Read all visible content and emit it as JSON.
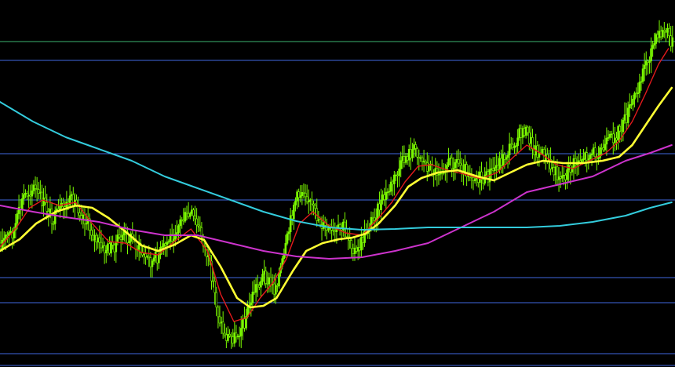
{
  "colors": {
    "background": "#000000",
    "candle": "#7CFC00",
    "horizontal_line_blue": "#4169E1",
    "horizontal_line_green": "#3CB371",
    "ma_red": "#E31A1C",
    "ma_yellow": "#FFFF33",
    "ma_magenta": "#CC33CC",
    "ma_cyan": "#33CCDD"
  },
  "chart_data": {
    "type": "line",
    "x_range": [
      0,
      410
    ],
    "y_range": [
      0,
      468
    ],
    "y_inverted": true,
    "grid": false,
    "legend": "none",
    "horizontal_levels": [
      {
        "color_key": "horizontal_line_green",
        "y": 53
      },
      {
        "color_key": "horizontal_line_blue",
        "y": 77
      },
      {
        "color_key": "horizontal_line_blue",
        "y": 196
      },
      {
        "color_key": "horizontal_line_blue",
        "y": 255
      },
      {
        "color_key": "horizontal_line_blue",
        "y": 354
      },
      {
        "color_key": "horizontal_line_blue",
        "y": 386
      },
      {
        "color_key": "horizontal_line_blue",
        "y": 451
      },
      {
        "color_key": "horizontal_line_blue",
        "y": 466
      }
    ],
    "price_path": [
      [
        0,
        310
      ],
      [
        8,
        295
      ],
      [
        14,
        250
      ],
      [
        20,
        240
      ],
      [
        26,
        260
      ],
      [
        32,
        280
      ],
      [
        38,
        265
      ],
      [
        44,
        255
      ],
      [
        50,
        275
      ],
      [
        56,
        300
      ],
      [
        62,
        320
      ],
      [
        68,
        315
      ],
      [
        74,
        300
      ],
      [
        80,
        305
      ],
      [
        86,
        325
      ],
      [
        92,
        335
      ],
      [
        98,
        320
      ],
      [
        104,
        300
      ],
      [
        110,
        280
      ],
      [
        116,
        275
      ],
      [
        122,
        300
      ],
      [
        128,
        350
      ],
      [
        132,
        400
      ],
      [
        136,
        430
      ],
      [
        142,
        430
      ],
      [
        148,
        410
      ],
      [
        154,
        370
      ],
      [
        160,
        350
      ],
      [
        166,
        370
      ],
      [
        172,
        330
      ],
      [
        178,
        260
      ],
      [
        184,
        240
      ],
      [
        190,
        270
      ],
      [
        196,
        290
      ],
      [
        202,
        300
      ],
      [
        208,
        290
      ],
      [
        212,
        305
      ],
      [
        216,
        325
      ],
      [
        222,
        295
      ],
      [
        228,
        270
      ],
      [
        234,
        250
      ],
      [
        240,
        225
      ],
      [
        246,
        200
      ],
      [
        252,
        190
      ],
      [
        258,
        210
      ],
      [
        264,
        220
      ],
      [
        270,
        210
      ],
      [
        276,
        205
      ],
      [
        282,
        215
      ],
      [
        288,
        225
      ],
      [
        294,
        230
      ],
      [
        300,
        215
      ],
      [
        306,
        200
      ],
      [
        312,
        180
      ],
      [
        318,
        165
      ],
      [
        324,
        190
      ],
      [
        330,
        200
      ],
      [
        336,
        220
      ],
      [
        342,
        225
      ],
      [
        348,
        210
      ],
      [
        354,
        200
      ],
      [
        360,
        195
      ],
      [
        366,
        190
      ],
      [
        372,
        175
      ],
      [
        378,
        160
      ],
      [
        384,
        130
      ],
      [
        390,
        90
      ],
      [
        396,
        60
      ],
      [
        400,
        45
      ],
      [
        404,
        40
      ],
      [
        408,
        55
      ]
    ],
    "series": [
      {
        "color_key": "ma_red",
        "values": [
          [
            0,
            315
          ],
          [
            10,
            290
          ],
          [
            18,
            265
          ],
          [
            26,
            255
          ],
          [
            36,
            262
          ],
          [
            46,
            258
          ],
          [
            56,
            285
          ],
          [
            66,
            308
          ],
          [
            76,
            310
          ],
          [
            86,
            322
          ],
          [
            96,
            325
          ],
          [
            106,
            308
          ],
          [
            116,
            292
          ],
          [
            126,
            320
          ],
          [
            134,
            375
          ],
          [
            142,
            410
          ],
          [
            150,
            405
          ],
          [
            158,
            380
          ],
          [
            166,
            360
          ],
          [
            174,
            330
          ],
          [
            182,
            285
          ],
          [
            190,
            270
          ],
          [
            200,
            288
          ],
          [
            210,
            297
          ],
          [
            220,
            300
          ],
          [
            230,
            278
          ],
          [
            238,
            258
          ],
          [
            246,
            232
          ],
          [
            254,
            212
          ],
          [
            262,
            210
          ],
          [
            272,
            217
          ],
          [
            282,
            222
          ],
          [
            292,
            228
          ],
          [
            302,
            220
          ],
          [
            312,
            200
          ],
          [
            320,
            185
          ],
          [
            328,
            195
          ],
          [
            338,
            210
          ],
          [
            348,
            215
          ],
          [
            358,
            205
          ],
          [
            368,
            195
          ],
          [
            376,
            180
          ],
          [
            384,
            155
          ],
          [
            392,
            120
          ],
          [
            400,
            82
          ],
          [
            406,
            62
          ]
        ]
      },
      {
        "color_key": "ma_yellow",
        "values": [
          [
            0,
            320
          ],
          [
            12,
            305
          ],
          [
            22,
            285
          ],
          [
            34,
            270
          ],
          [
            46,
            262
          ],
          [
            56,
            265
          ],
          [
            66,
            278
          ],
          [
            76,
            295
          ],
          [
            86,
            313
          ],
          [
            96,
            320
          ],
          [
            106,
            312
          ],
          [
            116,
            300
          ],
          [
            124,
            306
          ],
          [
            134,
            340
          ],
          [
            144,
            380
          ],
          [
            152,
            392
          ],
          [
            160,
            390
          ],
          [
            168,
            380
          ],
          [
            178,
            345
          ],
          [
            186,
            320
          ],
          [
            196,
            310
          ],
          [
            206,
            305
          ],
          [
            214,
            303
          ],
          [
            222,
            298
          ],
          [
            230,
            285
          ],
          [
            240,
            262
          ],
          [
            248,
            238
          ],
          [
            256,
            227
          ],
          [
            266,
            220
          ],
          [
            278,
            217
          ],
          [
            290,
            225
          ],
          [
            300,
            230
          ],
          [
            310,
            220
          ],
          [
            320,
            210
          ],
          [
            330,
            205
          ],
          [
            342,
            208
          ],
          [
            354,
            208
          ],
          [
            366,
            205
          ],
          [
            376,
            200
          ],
          [
            384,
            185
          ],
          [
            392,
            160
          ],
          [
            400,
            135
          ],
          [
            408,
            112
          ]
        ]
      },
      {
        "color_key": "ma_magenta",
        "values": [
          [
            0,
            262
          ],
          [
            20,
            270
          ],
          [
            40,
            277
          ],
          [
            60,
            283
          ],
          [
            80,
            293
          ],
          [
            100,
            300
          ],
          [
            120,
            300
          ],
          [
            140,
            310
          ],
          [
            160,
            320
          ],
          [
            180,
            327
          ],
          [
            200,
            330
          ],
          [
            220,
            328
          ],
          [
            240,
            320
          ],
          [
            260,
            310
          ],
          [
            280,
            290
          ],
          [
            300,
            270
          ],
          [
            320,
            245
          ],
          [
            340,
            235
          ],
          [
            360,
            225
          ],
          [
            380,
            205
          ],
          [
            395,
            195
          ],
          [
            408,
            185
          ]
        ]
      },
      {
        "color_key": "ma_cyan",
        "values": [
          [
            0,
            130
          ],
          [
            20,
            155
          ],
          [
            40,
            175
          ],
          [
            60,
            190
          ],
          [
            80,
            205
          ],
          [
            100,
            225
          ],
          [
            120,
            240
          ],
          [
            140,
            255
          ],
          [
            160,
            270
          ],
          [
            180,
            282
          ],
          [
            200,
            290
          ],
          [
            220,
            293
          ],
          [
            240,
            292
          ],
          [
            260,
            290
          ],
          [
            280,
            290
          ],
          [
            300,
            290
          ],
          [
            320,
            290
          ],
          [
            340,
            288
          ],
          [
            360,
            283
          ],
          [
            380,
            275
          ],
          [
            395,
            265
          ],
          [
            408,
            258
          ]
        ]
      }
    ]
  }
}
